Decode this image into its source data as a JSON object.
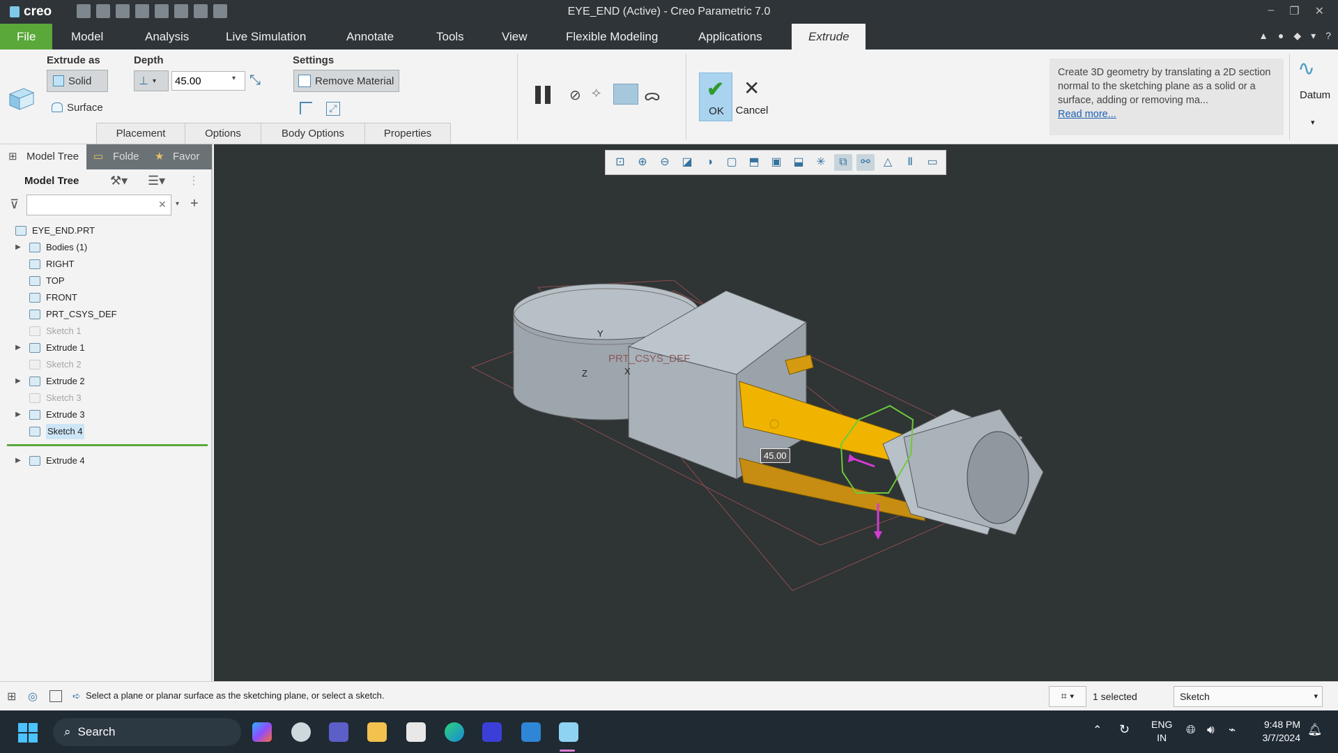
{
  "app": {
    "logo_text": "creo",
    "window_title": "EYE_END (Active) - Creo Parametric 7.0",
    "winctl": [
      "–",
      "❐",
      "✕"
    ]
  },
  "tabs": [
    "File",
    "Model",
    "Analysis",
    "Live Simulation",
    "Annotate",
    "Tools",
    "View",
    "Flexible Modeling",
    "Applications",
    "Extrude"
  ],
  "ribbon": {
    "extrude_as_label": "Extrude as",
    "solid_label": "Solid",
    "surface_label": "Surface",
    "depth_label": "Depth",
    "depth_value": "45.00",
    "settings_label": "Settings",
    "remove_material_label": "Remove Material",
    "ok_label": "OK",
    "cancel_label": "Cancel",
    "help_text": "Create 3D geometry by translating a 2D section normal to the sketching plane as a solid or a surface, adding or removing ma...",
    "read_more": "Read more...",
    "datum_label": "Datum",
    "subtabs": [
      "Placement",
      "Options",
      "Body Options",
      "Properties"
    ]
  },
  "left_panel": {
    "tabs": [
      "Model Tree",
      "Folde",
      "Favor"
    ],
    "header": "Model Tree",
    "search_placeholder": "",
    "items": [
      {
        "label": "EYE_END.PRT",
        "expander": ""
      },
      {
        "label": "Bodies (1)",
        "expander": "▶"
      },
      {
        "label": "RIGHT",
        "expander": ""
      },
      {
        "label": "TOP",
        "expander": ""
      },
      {
        "label": "FRONT",
        "expander": ""
      },
      {
        "label": "PRT_CSYS_DEF",
        "expander": ""
      },
      {
        "label": "Sketch 1",
        "expander": ""
      },
      {
        "label": "Extrude 1",
        "expander": "▶"
      },
      {
        "label": "Sketch 2",
        "expander": ""
      },
      {
        "label": "Extrude 2",
        "expander": "▶"
      },
      {
        "label": "Sketch 3",
        "expander": ""
      },
      {
        "label": "Extrude 3",
        "expander": "▶"
      },
      {
        "label": "Sketch 4",
        "expander": ""
      },
      {
        "label": "Extrude 4",
        "expander": "▶"
      }
    ]
  },
  "viewport": {
    "csys_label": "PRT_CSYS_DEF",
    "axis_y": "Y",
    "axis_z": "Z",
    "axis_x": "X",
    "dimension": "45.00"
  },
  "status": {
    "message": "Select a plane or planar surface as the sketching plane, or select a sketch.",
    "selected": "1 selected",
    "filter": "Sketch"
  },
  "taskbar": {
    "search": "Search",
    "lang_top": "ENG",
    "lang_bottom": "IN",
    "time": "9:48 PM",
    "date": "3/7/2024"
  }
}
